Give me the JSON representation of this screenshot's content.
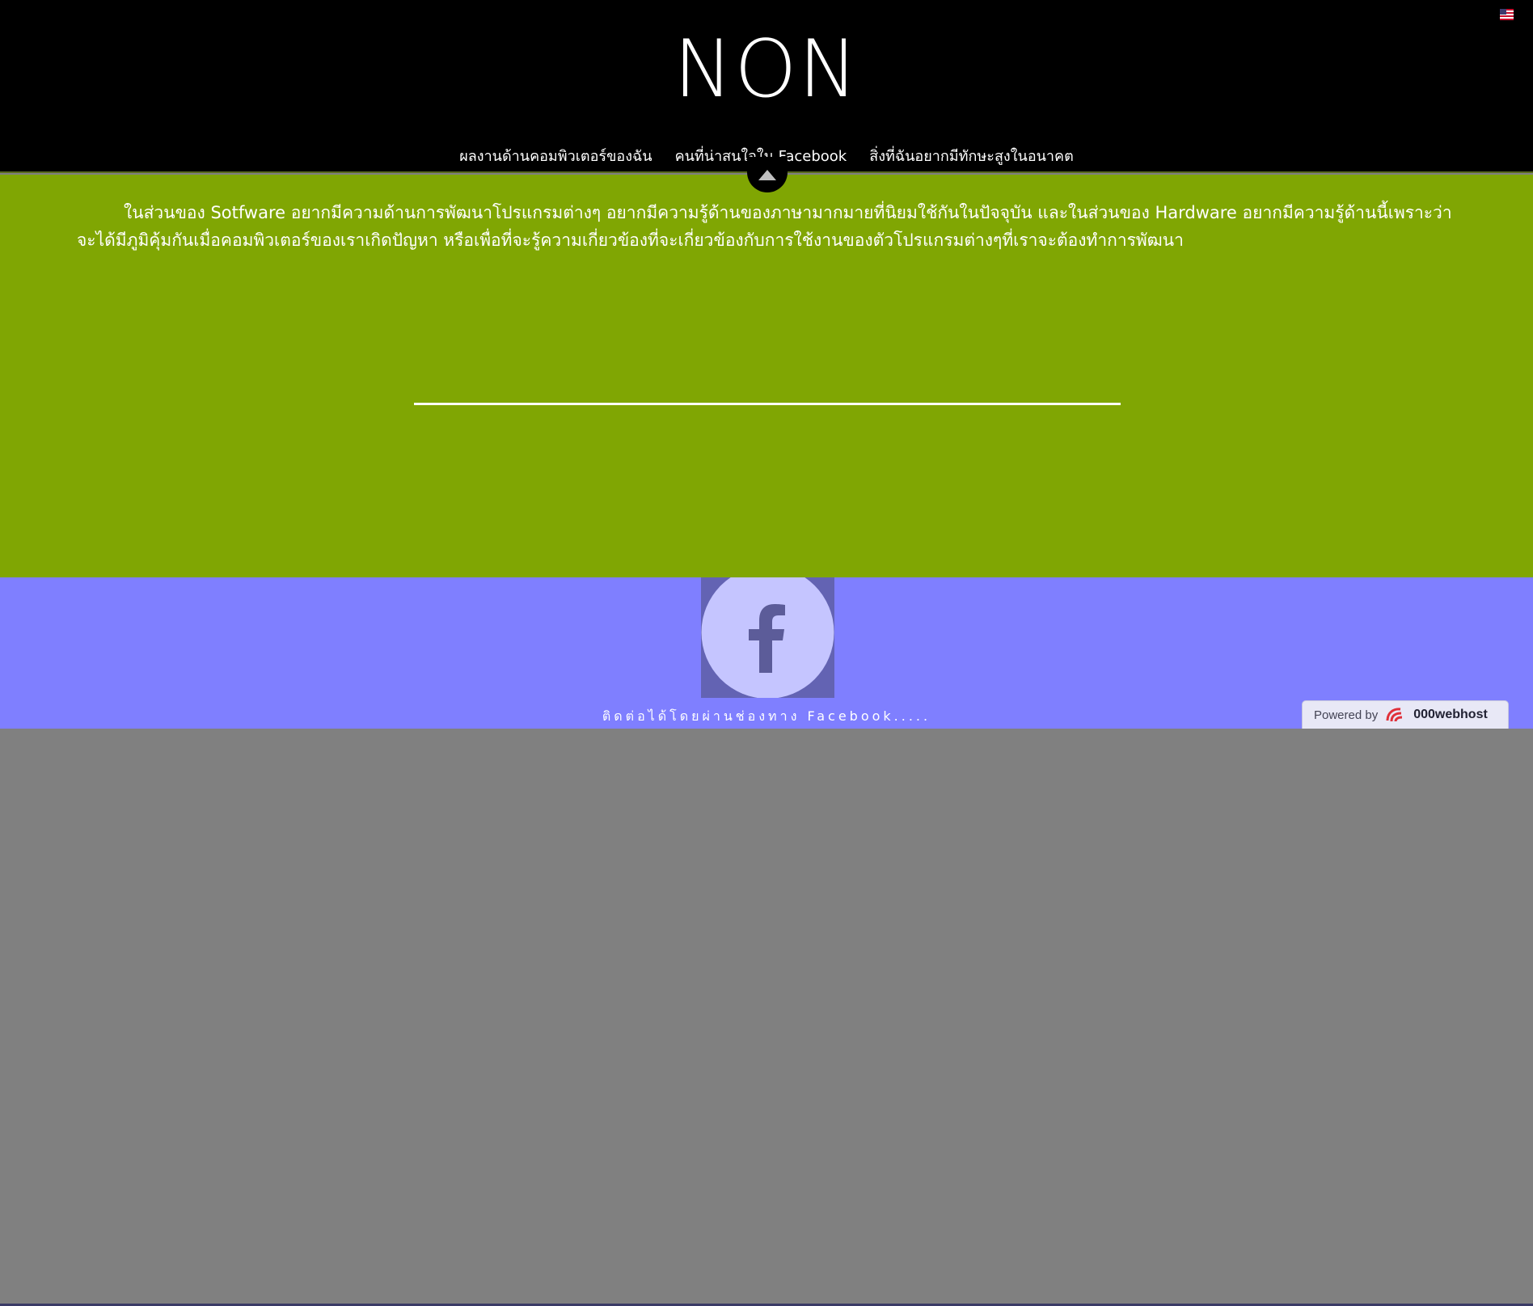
{
  "header": {
    "site_title": "NON",
    "flag_icon": "us-flag-icon",
    "nav": [
      {
        "label": "ผลงานด้านคอมพิวเตอร์ของฉัน"
      },
      {
        "label": "คนที่น่าสนใจใน Facebook"
      },
      {
        "label": "สิ่งที่ฉันอยากมีทักษะสูงในอนาคต"
      }
    ],
    "scroll_top_icon": "chevron-up-icon"
  },
  "main": {
    "paragraph": "ในส่วนของ Sotfware อยากมีความด้านการพัฒนาโปรแกรมต่างๆ อยากมีความรู้ด้านของภาษามากมายที่นิยมใช้กันในปัจจุบัน และในส่วนของ Hardware อยากมีความรู้ด้านนี้เพราะว่าจะได้มีภูมิคุ้มกันเมื่อคอมพิวเตอร์ของเราเกิดปัญหา หรือเพื่อที่จะรู้ความเกี่ยวข้องที่จะเกี่ยวข้องกับการใช้งานของตัวโปรแกรมต่างๆที่เราจะต้องทำการพัฒนา"
  },
  "footer": {
    "facebook_icon": "facebook-icon",
    "contact_text": "ติดต่อได้โดยผ่านช่องทาง Facebook.....",
    "powered_label": "Powered by",
    "powered_brand": "000webhost"
  },
  "colors": {
    "header_bg": "#000000",
    "main_bg": "#80a603",
    "footer_bg": "#7f7fff",
    "facebook_box_bg": "#6363b3"
  }
}
